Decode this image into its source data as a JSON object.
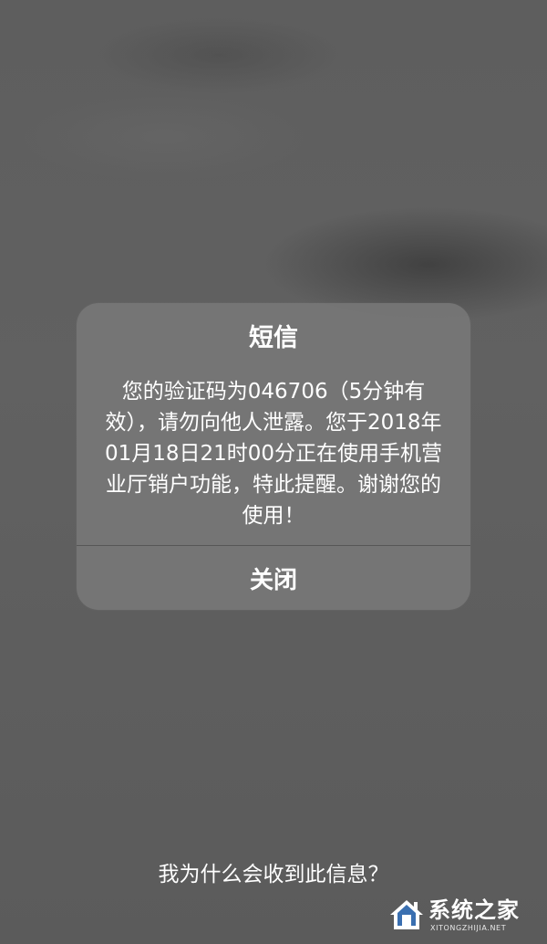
{
  "alert": {
    "title": "短信",
    "message": "您的验证码为046706（5分钟有效），请勿向他人泄露。您于2018年01月18日21时00分正在使用手机营业厅销户功能，特此提醒。谢谢您的使用！",
    "close_label": "关闭"
  },
  "footer": {
    "why_link": "我为什么会收到此信息？"
  },
  "watermark": {
    "title": "系统之家",
    "subtitle": "XITONGZHIJIA.NET"
  },
  "colors": {
    "background": "#5f5f5f",
    "alert_background": "#767676",
    "text": "#ffffff"
  }
}
